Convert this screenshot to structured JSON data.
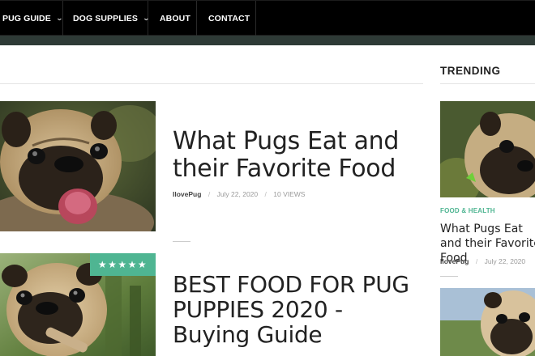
{
  "nav": {
    "items": [
      {
        "label": "PUG GUIDE",
        "dropdown": true
      },
      {
        "label": "DOG SUPPLIES",
        "dropdown": true
      },
      {
        "label": "ABOUT",
        "dropdown": false
      },
      {
        "label": "CONTACT",
        "dropdown": false
      }
    ],
    "dropdown_glyph": "⌄"
  },
  "posts": [
    {
      "title": "What Pugs Eat and their Favorite Food",
      "author": "IlovePug",
      "date": "July 22, 2020",
      "views": "10 VIEWS",
      "image": "pug-tongue-photo"
    },
    {
      "title": "BEST FOOD FOR PUG PUPPIES 2020 - Buying Guide",
      "rating_stars": 5,
      "stars_text": "★★★★★",
      "image": "pug-puppy-stick-photo"
    }
  ],
  "sidebar": {
    "heading": "TRENDING",
    "item": {
      "category": "FOOD & HEALTH",
      "title": "What Pugs Eat and their Favorite Food",
      "author": "IlovePug",
      "date": "July 22, 2020"
    }
  },
  "meta_separator": "/",
  "colors": {
    "nav_bg": "#000000",
    "accent_bar": "#2e3a36",
    "accent_green": "#4fb592",
    "text_dark": "#222222",
    "text_muted": "#9a9a9a"
  }
}
